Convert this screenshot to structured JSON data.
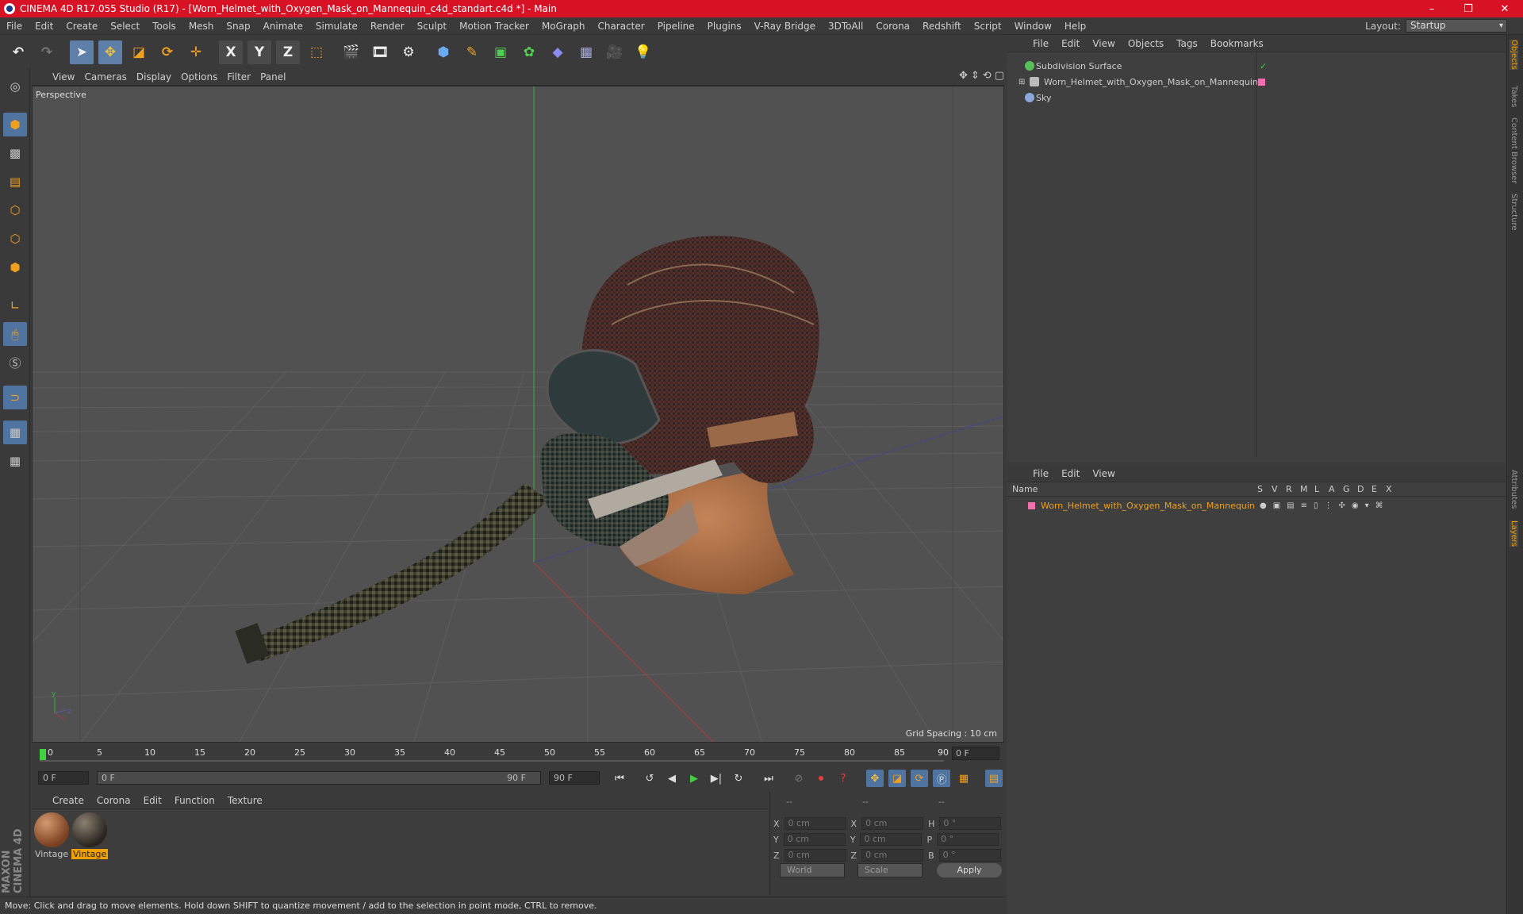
{
  "window": {
    "title": "CINEMA 4D R17.055 Studio (R17) - [Worn_Helmet_with_Oxygen_Mask_on_Mannequin_c4d_standart.c4d *] - Main",
    "minimize": "–",
    "restore": "❐",
    "close": "✕"
  },
  "menu": [
    "File",
    "Edit",
    "Create",
    "Select",
    "Tools",
    "Mesh",
    "Snap",
    "Animate",
    "Simulate",
    "Render",
    "Sculpt",
    "Motion Tracker",
    "MoGraph",
    "Character",
    "Pipeline",
    "Plugins",
    "V-Ray Bridge",
    "3DToAll",
    "Corona",
    "Redshift",
    "Script",
    "Window",
    "Help"
  ],
  "layout": {
    "label": "Layout:",
    "value": "Startup"
  },
  "toolbar": {
    "icons": [
      "undo-icon",
      "redo-icon",
      "select-arrow-icon",
      "move-icon",
      "scale-icon",
      "rotate-icon",
      "move-plus-icon",
      "x-axis-icon",
      "y-axis-icon",
      "z-axis-icon",
      "world-coords-icon",
      "render-view-icon",
      "render-picture-icon",
      "render-settings-icon",
      "cube-icon",
      "pen-icon",
      "subdivision-icon",
      "mograph-icon",
      "deformer-icon",
      "floor-icon",
      "camera-icon",
      "light-icon"
    ],
    "x_label": "X",
    "y_label": "Y",
    "z_label": "Z"
  },
  "viewport": {
    "menu": [
      "View",
      "Cameras",
      "Display",
      "Options",
      "Filter",
      "Panel"
    ],
    "label": "Perspective",
    "grid_spacing": "Grid Spacing : 10 cm"
  },
  "timeline": {
    "ticks": [
      "0",
      "5",
      "10",
      "15",
      "20",
      "25",
      "30",
      "35",
      "40",
      "45",
      "50",
      "55",
      "60",
      "65",
      "70",
      "75",
      "80",
      "85",
      "90"
    ],
    "end_frame": "0 F"
  },
  "transport": {
    "start": "0 F",
    "slider_start": "0 F",
    "slider_end": "90 F",
    "end": "90 F"
  },
  "materials": {
    "menu": [
      "Create",
      "Corona",
      "Edit",
      "Function",
      "Texture"
    ],
    "items": [
      {
        "name": "Vintage",
        "selected": false
      },
      {
        "name": "Vintage",
        "selected": true
      }
    ]
  },
  "coords": {
    "header": [
      "--",
      "--",
      "--"
    ],
    "rows": [
      {
        "a": "X",
        "v1": "0 cm",
        "b": "X",
        "v2": "0 cm",
        "c": "H",
        "v3": "0 °"
      },
      {
        "a": "Y",
        "v1": "0 cm",
        "b": "Y",
        "v2": "0 cm",
        "c": "P",
        "v3": "0 °"
      },
      {
        "a": "Z",
        "v1": "0 cm",
        "b": "Z",
        "v2": "0 cm",
        "c": "B",
        "v3": "0 °"
      }
    ],
    "world": "World",
    "scale": "Scale",
    "apply": "Apply"
  },
  "status": "Move: Click and drag to move elements. Hold down SHIFT to quantize movement / add to the selection in point mode, CTRL to remove.",
  "objects": {
    "menu": [
      "File",
      "Edit",
      "View",
      "Objects",
      "Tags",
      "Bookmarks"
    ],
    "items": [
      {
        "name": "Subdivision Surface",
        "color": "#58c058"
      },
      {
        "name": "Worn_Helmet_with_Oxygen_Mask_on_Mannequin",
        "color": "#d0d0d0"
      },
      {
        "name": "Sky",
        "color": "#8aa8d8"
      }
    ]
  },
  "layers": {
    "menu": [
      "File",
      "Edit",
      "View"
    ],
    "header": {
      "name": "Name",
      "flags": [
        "S",
        "V",
        "R",
        "M",
        "L",
        "A",
        "G",
        "D",
        "E",
        "X"
      ]
    },
    "items": [
      {
        "name": "Worn_Helmet_with_Oxygen_Mask_on_Mannequin",
        "color": "#f080c0"
      }
    ]
  },
  "right_tabs": [
    "Objects",
    "Takes",
    "Content Browser",
    "Structure",
    "Attributes",
    "Layers"
  ],
  "brand": "MAXON CINEMA 4D"
}
